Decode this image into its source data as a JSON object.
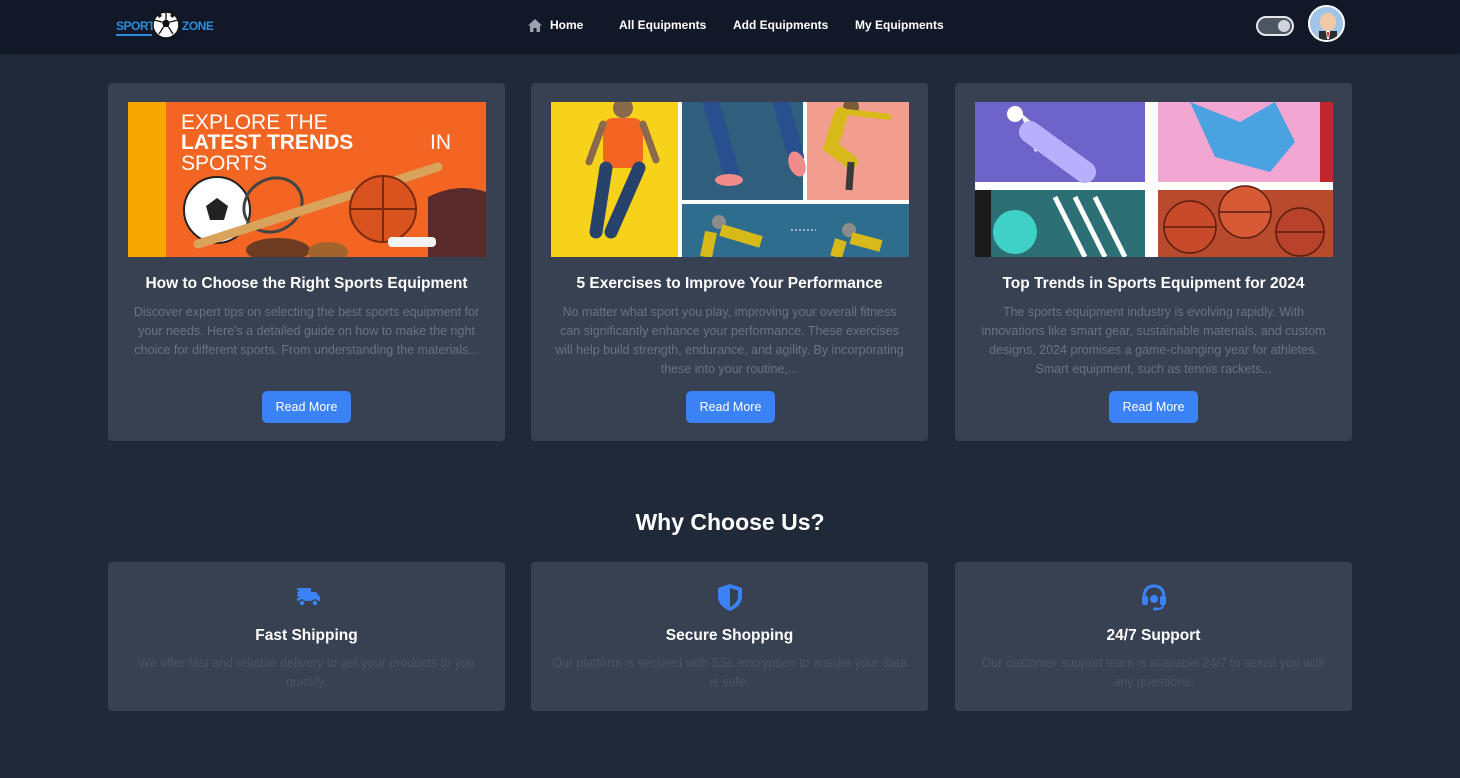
{
  "brand": {
    "logo_left": "SPORTS",
    "logo_right": "ZONE",
    "color": "#2b8ee0"
  },
  "nav": {
    "items": [
      {
        "label": "Home",
        "icon": "home-icon"
      },
      {
        "label": "All Equipments"
      },
      {
        "label": "Add Equipments"
      },
      {
        "label": "My Equipments"
      }
    ],
    "theme_toggle": "dark",
    "avatar": "user-avatar"
  },
  "blog": {
    "cards": [
      {
        "banner_line1": "EXPLORE THE",
        "banner_line2_bold": "LATEST TRENDS",
        "banner_line2_rest": "IN",
        "banner_line3": "SPORTS",
        "title": "How to Choose the Right Sports Equipment",
        "description": "Discover expert tips on selecting the best sports equipment for your needs. Here's a detailed guide on how to make the right choice for different sports. From understanding the materials...",
        "button": "Read More"
      },
      {
        "title": "5 Exercises to Improve Your Performance",
        "description": "No matter what sport you play, improving your overall fitness can significantly enhance your performance. These exercises will help build strength, endurance, and agility. By incorporating these into your routine,...",
        "button": "Read More"
      },
      {
        "title": "Top Trends in Sports Equipment for 2024",
        "description": "The sports equipment industry is evolving rapidly. With innovations like smart gear, sustainable materials, and custom designs, 2024 promises a game-changing year for athletes. Smart equipment, such as tennis rackets...",
        "button": "Read More"
      }
    ]
  },
  "why": {
    "title": "Why Choose Us?",
    "features": [
      {
        "icon": "truck-icon",
        "title": "Fast Shipping",
        "description": "We offer fast and reliable delivery to get your products to you quickly."
      },
      {
        "icon": "shield-icon",
        "title": "Secure Shopping",
        "description": "Our platform is secured with SSL encryption to ensure your data is safe."
      },
      {
        "icon": "headset-icon",
        "title": "24/7 Support",
        "description": "Our customer support team is available 24/7 to assist you with any questions."
      }
    ]
  },
  "colors": {
    "page_bg": "#1f2937",
    "navbar_bg": "#111827",
    "card_bg": "#374151",
    "accent": "#3b82f6",
    "muted_text": "#6b7280"
  }
}
